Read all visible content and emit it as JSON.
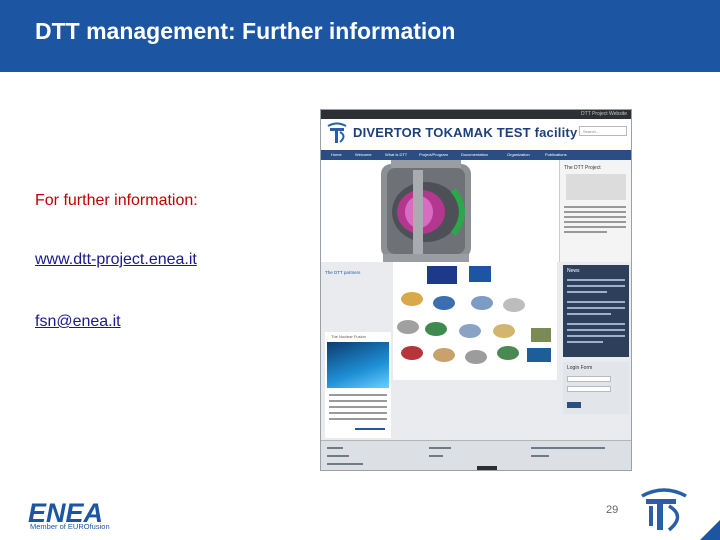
{
  "slide": {
    "title": "DTT management: Further information",
    "info_label": "For further information:",
    "website_link": "www.dtt-project.enea.it",
    "email_link": "fsn@enea.it",
    "slide_number": "29"
  },
  "enea_logo": {
    "wordmark": "ENEA",
    "subtitle": "Member of EUROfusion"
  },
  "embedded_site": {
    "site_name": "DIVERTOR TOKAMAK TEST facility",
    "top_strip_text": "DTT Project Website",
    "search_placeholder": "Search...",
    "nav_items": [
      "Home",
      "Welcome",
      "What is DTT",
      "Project/Program",
      "Documentation",
      "Organization",
      "Publications"
    ],
    "side_heading": "The DTT Project",
    "partners_heading": "The DTT partners",
    "news_heading": "News",
    "login_heading": "Login Form",
    "left_caption": "The Nuclear Fusion"
  },
  "colors": {
    "title_bar": "#1c56a3",
    "info_label": "#c00000",
    "link": "#1a1a8c"
  }
}
